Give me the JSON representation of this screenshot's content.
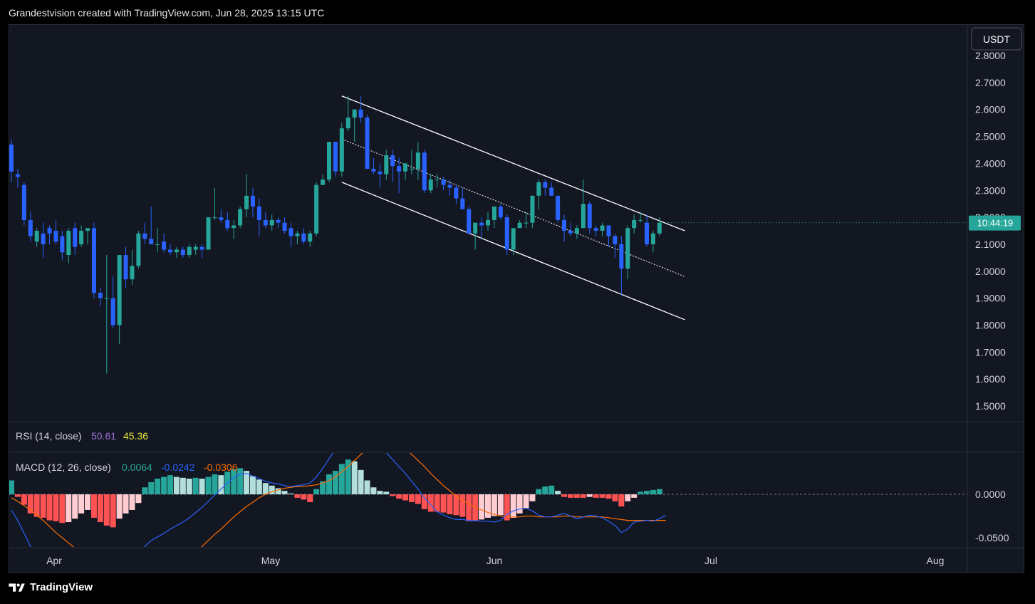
{
  "header": {
    "caption": "Grandestvision created with TradingView.com, Jun 28, 2025 13:15 UTC"
  },
  "footer": {
    "brand": "TradingView"
  },
  "colors": {
    "up": "#26a69a",
    "down": "#2962ff",
    "bg": "#131722",
    "grid": "#2a2e39",
    "channel": "#ffffff",
    "hist_up_strong": "#26a69a",
    "hist_up_weak": "#b2dfdb",
    "hist_down_strong": "#ff5252",
    "hist_down_weak": "#ffcdd2",
    "macd_line": "#2962ff",
    "signal_line": "#ff6d00",
    "rsi_value": "#9c6fd6",
    "rsi_ma": "#e8e83a"
  },
  "chart_data": {
    "type": "candlestick",
    "currency": "USDT",
    "countdown": "10:44:19",
    "price_axis": {
      "min": 1.45,
      "max": 2.82,
      "ticks": [
        "2.8000",
        "2.7000",
        "2.6000",
        "2.5000",
        "2.4000",
        "2.3000",
        "2.2000",
        "2.1000",
        "2.0000",
        "1.9000",
        "1.8000",
        "1.7000",
        "1.6000",
        "1.5000"
      ]
    },
    "time_labels": [
      "Apr",
      "May",
      "Jun",
      "Jul",
      "Aug"
    ],
    "candles": [
      [
        2.47,
        2.49,
        2.33,
        2.37
      ],
      [
        2.36,
        2.38,
        2.31,
        2.35
      ],
      [
        2.32,
        2.33,
        2.17,
        2.19
      ],
      [
        2.19,
        2.22,
        2.11,
        2.13
      ],
      [
        2.11,
        2.16,
        2.09,
        2.15
      ],
      [
        2.14,
        2.18,
        2.05,
        2.1
      ],
      [
        2.16,
        2.17,
        2.1,
        2.14
      ],
      [
        2.15,
        2.19,
        2.1,
        2.11
      ],
      [
        2.13,
        2.15,
        2.04,
        2.07
      ],
      [
        2.06,
        2.16,
        2.03,
        2.15
      ],
      [
        2.16,
        2.18,
        2.06,
        2.09
      ],
      [
        2.1,
        2.17,
        2.09,
        2.15
      ],
      [
        2.15,
        2.16,
        2.1,
        2.16
      ],
      [
        2.16,
        2.18,
        1.9,
        1.92
      ],
      [
        1.92,
        1.94,
        1.87,
        1.9
      ],
      [
        1.9,
        2.06,
        1.62,
        1.9
      ],
      [
        1.9,
        1.98,
        1.79,
        1.8
      ],
      [
        1.8,
        2.06,
        1.73,
        2.06
      ],
      [
        2.06,
        2.09,
        1.94,
        1.97
      ],
      [
        1.97,
        2.08,
        1.95,
        2.02
      ],
      [
        2.02,
        2.15,
        2.01,
        2.14
      ],
      [
        2.14,
        2.18,
        2.1,
        2.12
      ],
      [
        2.12,
        2.24,
        2.1,
        2.1
      ],
      [
        2.1,
        2.16,
        2.07,
        2.1
      ],
      [
        2.11,
        2.14,
        2.07,
        2.08
      ],
      [
        2.08,
        2.1,
        2.06,
        2.07
      ],
      [
        2.07,
        2.09,
        2.05,
        2.08
      ],
      [
        2.08,
        2.09,
        2.05,
        2.06
      ],
      [
        2.06,
        2.1,
        2.05,
        2.09
      ],
      [
        2.08,
        2.1,
        2.06,
        2.09
      ],
      [
        2.09,
        2.1,
        2.05,
        2.08
      ],
      [
        2.08,
        2.2,
        2.08,
        2.2
      ],
      [
        2.2,
        2.31,
        2.19,
        2.2
      ],
      [
        2.2,
        2.23,
        2.18,
        2.19
      ],
      [
        2.19,
        2.22,
        2.15,
        2.16
      ],
      [
        2.16,
        2.19,
        2.12,
        2.17
      ],
      [
        2.17,
        2.24,
        2.16,
        2.23
      ],
      [
        2.23,
        2.36,
        2.2,
        2.28
      ],
      [
        2.28,
        2.31,
        2.2,
        2.24
      ],
      [
        2.24,
        2.27,
        2.13,
        2.19
      ],
      [
        2.19,
        2.22,
        2.16,
        2.17
      ],
      [
        2.17,
        2.21,
        2.15,
        2.19
      ],
      [
        2.19,
        2.2,
        2.16,
        2.18
      ],
      [
        2.18,
        2.2,
        2.14,
        2.15
      ],
      [
        2.16,
        2.18,
        2.09,
        2.13
      ],
      [
        2.13,
        2.15,
        2.1,
        2.14
      ],
      [
        2.14,
        2.16,
        2.1,
        2.11
      ],
      [
        2.11,
        2.15,
        2.09,
        2.14
      ],
      [
        2.14,
        2.33,
        2.13,
        2.32
      ],
      [
        2.32,
        2.36,
        2.32,
        2.34
      ],
      [
        2.34,
        2.48,
        2.33,
        2.48
      ],
      [
        2.48,
        2.48,
        2.35,
        2.37
      ],
      [
        2.37,
        2.55,
        2.35,
        2.53
      ],
      [
        2.53,
        2.65,
        2.52,
        2.57
      ],
      [
        2.57,
        2.6,
        2.48,
        2.6
      ],
      [
        2.6,
        2.65,
        2.55,
        2.57
      ],
      [
        2.57,
        2.58,
        2.38,
        2.38
      ],
      [
        2.38,
        2.42,
        2.36,
        2.37
      ],
      [
        2.37,
        2.4,
        2.31,
        2.36
      ],
      [
        2.36,
        2.45,
        2.34,
        2.43
      ],
      [
        2.43,
        2.45,
        2.33,
        2.39
      ],
      [
        2.39,
        2.42,
        2.29,
        2.37
      ],
      [
        2.37,
        2.4,
        2.34,
        2.4
      ],
      [
        2.38,
        2.45,
        2.36,
        2.38
      ],
      [
        2.38,
        2.48,
        2.34,
        2.44
      ],
      [
        2.44,
        2.45,
        2.29,
        2.3
      ],
      [
        2.3,
        2.36,
        2.29,
        2.34
      ],
      [
        2.34,
        2.36,
        2.31,
        2.34
      ],
      [
        2.34,
        2.35,
        2.3,
        2.32
      ],
      [
        2.32,
        2.34,
        2.28,
        2.31
      ],
      [
        2.31,
        2.32,
        2.25,
        2.27
      ],
      [
        2.27,
        2.31,
        2.24,
        2.23
      ],
      [
        2.23,
        2.24,
        2.14,
        2.14
      ],
      [
        2.14,
        2.18,
        2.08,
        2.18
      ],
      [
        2.18,
        2.2,
        2.12,
        2.17
      ],
      [
        2.17,
        2.22,
        2.15,
        2.19
      ],
      [
        2.19,
        2.22,
        2.16,
        2.24
      ],
      [
        2.24,
        2.25,
        2.19,
        2.2
      ],
      [
        2.2,
        2.21,
        2.06,
        2.08
      ],
      [
        2.08,
        2.15,
        2.06,
        2.16
      ],
      [
        2.16,
        2.19,
        2.16,
        2.18
      ],
      [
        2.18,
        2.22,
        2.16,
        2.18
      ],
      [
        2.18,
        2.28,
        2.16,
        2.28
      ],
      [
        2.28,
        2.34,
        2.23,
        2.33
      ],
      [
        2.33,
        2.34,
        2.28,
        2.31
      ],
      [
        2.31,
        2.33,
        2.29,
        2.28
      ],
      [
        2.28,
        2.28,
        2.18,
        2.19
      ],
      [
        2.19,
        2.21,
        2.11,
        2.15
      ],
      [
        2.15,
        2.18,
        2.13,
        2.14
      ],
      [
        2.14,
        2.17,
        2.12,
        2.16
      ],
      [
        2.16,
        2.34,
        2.16,
        2.25
      ],
      [
        2.25,
        2.26,
        2.14,
        2.16
      ],
      [
        2.16,
        2.17,
        2.13,
        2.15
      ],
      [
        2.15,
        2.18,
        2.13,
        2.17
      ],
      [
        2.17,
        2.17,
        2.09,
        2.13
      ],
      [
        2.13,
        2.14,
        2.05,
        2.1
      ],
      [
        2.1,
        2.13,
        1.91,
        2.01
      ],
      [
        2.01,
        2.17,
        1.97,
        2.16
      ],
      [
        2.16,
        2.21,
        2.14,
        2.19
      ],
      [
        2.19,
        2.22,
        2.18,
        2.19
      ],
      [
        2.18,
        2.21,
        2.09,
        2.1
      ],
      [
        2.1,
        2.15,
        2.07,
        2.14
      ],
      [
        2.14,
        2.2,
        2.13,
        2.18
      ]
    ],
    "channel_lines": {
      "upper": [
        [
          52,
          2.65
        ],
        [
          106,
          2.15
        ]
      ],
      "mid": [
        [
          52,
          2.49
        ],
        [
          106,
          1.98
        ]
      ],
      "lower": [
        [
          52,
          2.33
        ],
        [
          106,
          1.82
        ]
      ]
    },
    "rsi": {
      "label": "RSI (14, close)",
      "value": "50.61",
      "ma": "45.36"
    },
    "macd": {
      "label": "MACD (12, 26, close)",
      "hist_value": "0.0064",
      "macd_value": "-0.0242",
      "signal_value": "-0.0306",
      "axis_ticks": [
        "0.0000",
        "-0.0500"
      ],
      "axis_range": [
        -0.062,
        0.047
      ],
      "hist": [
        0.016,
        -0.003,
        -0.012,
        -0.022,
        -0.026,
        -0.027,
        -0.03,
        -0.031,
        -0.033,
        -0.032,
        -0.028,
        -0.022,
        -0.018,
        -0.027,
        -0.032,
        -0.036,
        -0.038,
        -0.028,
        -0.022,
        -0.018,
        -0.01,
        0.008,
        0.014,
        0.018,
        0.02,
        0.022,
        0.02,
        0.019,
        0.018,
        0.019,
        0.018,
        0.02,
        0.023,
        0.022,
        0.026,
        0.029,
        0.03,
        0.027,
        0.021,
        0.017,
        0.013,
        0.01,
        0.007,
        0.004,
        0.001,
        -0.004,
        -0.006,
        -0.009,
        0.006,
        0.015,
        0.023,
        0.027,
        0.035,
        0.04,
        0.038,
        0.028,
        0.016,
        0.008,
        0.004,
        0.003,
        -0.002,
        -0.005,
        -0.007,
        -0.009,
        -0.011,
        -0.017,
        -0.02,
        -0.02,
        -0.021,
        -0.023,
        -0.024,
        -0.026,
        -0.031,
        -0.031,
        -0.029,
        -0.027,
        -0.025,
        -0.024,
        -0.03,
        -0.027,
        -0.022,
        -0.016,
        -0.008,
        0.006,
        0.009,
        0.01,
        0.004,
        -0.003,
        -0.004,
        -0.004,
        -0.004,
        -0.003,
        -0.004,
        -0.004,
        -0.005,
        -0.008,
        -0.014,
        -0.008,
        -0.004,
        0.003,
        0.004,
        0.005,
        0.006
      ],
      "macd_line": [
        -0.018,
        -0.03,
        -0.045,
        -0.06,
        -0.075,
        -0.088,
        -0.1,
        -0.108,
        -0.115,
        -0.12,
        -0.121,
        -0.118,
        -0.112,
        -0.11,
        -0.108,
        -0.106,
        -0.104,
        -0.098,
        -0.089,
        -0.078,
        -0.067,
        -0.06,
        -0.053,
        -0.049,
        -0.045,
        -0.04,
        -0.036,
        -0.032,
        -0.027,
        -0.021,
        -0.015,
        -0.008,
        -0.001,
        0.006,
        0.013,
        0.019,
        0.023,
        0.024,
        0.021,
        0.018,
        0.015,
        0.013,
        0.012,
        0.01,
        0.009,
        0.01,
        0.011,
        0.013,
        0.02,
        0.03,
        0.041,
        0.052,
        0.063,
        0.072,
        0.076,
        0.073,
        0.068,
        0.062,
        0.055,
        0.048,
        0.04,
        0.032,
        0.024,
        0.015,
        0.006,
        -0.004,
        -0.012,
        -0.02,
        -0.024,
        -0.027,
        -0.029,
        -0.029,
        -0.03,
        -0.03,
        -0.031,
        -0.031,
        -0.032,
        -0.03,
        -0.023,
        -0.019,
        -0.017,
        -0.016,
        -0.019,
        -0.024,
        -0.026,
        -0.026,
        -0.024,
        -0.022,
        -0.025,
        -0.028,
        -0.026,
        -0.024,
        -0.025,
        -0.027,
        -0.031,
        -0.036,
        -0.044,
        -0.04,
        -0.032,
        -0.031,
        -0.03,
        -0.031,
        -0.028,
        -0.024
      ],
      "signal_line": [
        -0.004,
        -0.008,
        -0.013,
        -0.018,
        -0.024,
        -0.03,
        -0.037,
        -0.044,
        -0.05,
        -0.056,
        -0.062,
        -0.067,
        -0.072,
        -0.077,
        -0.082,
        -0.087,
        -0.092,
        -0.096,
        -0.099,
        -0.101,
        -0.102,
        -0.101,
        -0.099,
        -0.096,
        -0.092,
        -0.088,
        -0.083,
        -0.078,
        -0.072,
        -0.066,
        -0.06,
        -0.053,
        -0.046,
        -0.04,
        -0.033,
        -0.026,
        -0.02,
        -0.014,
        -0.009,
        -0.004,
        0.0,
        0.003,
        0.005,
        0.007,
        0.008,
        0.009,
        0.009,
        0.01,
        0.011,
        0.013,
        0.016,
        0.02,
        0.026,
        0.032,
        0.039,
        0.046,
        0.052,
        0.057,
        0.06,
        0.061,
        0.06,
        0.057,
        0.052,
        0.046,
        0.039,
        0.032,
        0.024,
        0.017,
        0.01,
        0.004,
        -0.002,
        -0.007,
        -0.011,
        -0.015,
        -0.018,
        -0.021,
        -0.023,
        -0.025,
        -0.026,
        -0.026,
        -0.026,
        -0.025,
        -0.025,
        -0.026,
        -0.026,
        -0.026,
        -0.026,
        -0.025,
        -0.025,
        -0.026,
        -0.026,
        -0.026,
        -0.026,
        -0.026,
        -0.027,
        -0.028,
        -0.029,
        -0.03,
        -0.03,
        -0.03,
        -0.03,
        -0.03,
        -0.03,
        -0.03
      ]
    }
  }
}
